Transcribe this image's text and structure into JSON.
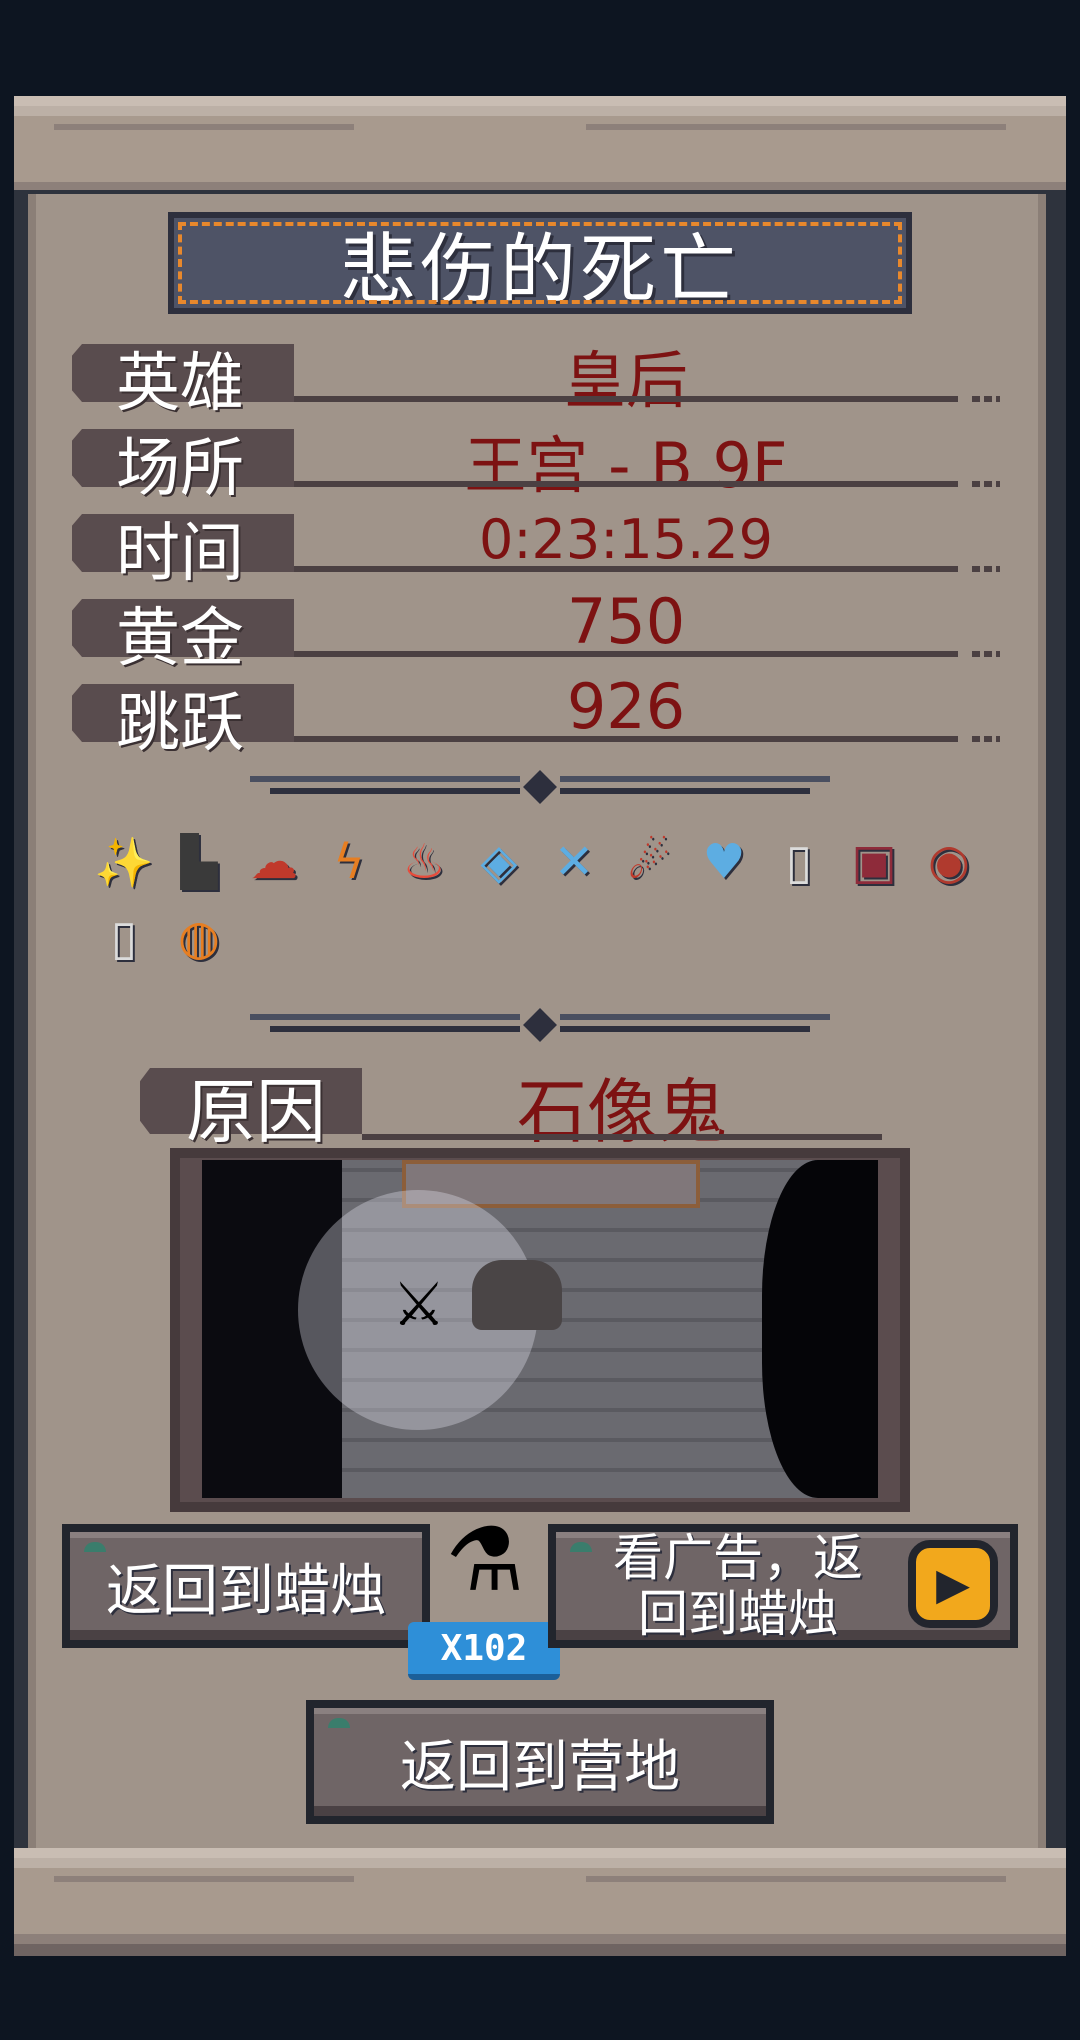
{
  "title": "悲伤的死亡",
  "stats": [
    {
      "label": "英雄",
      "value": "皇后"
    },
    {
      "label": "场所",
      "value": "王宫 - B 9F"
    },
    {
      "label": "时间",
      "value": "0:23:15.29"
    },
    {
      "label": "黄金",
      "value": "750"
    },
    {
      "label": "跳跃",
      "value": "926"
    }
  ],
  "items": [
    {
      "icon": "stars-icon",
      "glyph": "✨",
      "color": "#7ab8ff"
    },
    {
      "icon": "boot-icon",
      "glyph": "▙",
      "color": "#3a3a3a"
    },
    {
      "icon": "mushroom-cloud-icon",
      "glyph": "☁",
      "color": "#c0392b"
    },
    {
      "icon": "lightning-icon",
      "glyph": "ϟ",
      "color": "#e67e22"
    },
    {
      "icon": "fire-icon",
      "glyph": "♨",
      "color": "#e74c3c"
    },
    {
      "icon": "ice-cube-icon",
      "glyph": "◈",
      "color": "#5dade2"
    },
    {
      "icon": "crossed-swords-icon",
      "glyph": "✕",
      "color": "#5dade2"
    },
    {
      "icon": "comet-icon",
      "glyph": "☄",
      "color": "#c0392b"
    },
    {
      "icon": "heart-icon",
      "glyph": "♥",
      "color": "#5dade2"
    },
    {
      "icon": "jar-icon",
      "glyph": "▯",
      "color": "#dcdcdc"
    },
    {
      "icon": "chest-icon",
      "glyph": "▣",
      "color": "#8e2b3a"
    },
    {
      "icon": "target-icon",
      "glyph": "◉",
      "color": "#b03a2e"
    },
    {
      "icon": "jar-icon",
      "glyph": "▯",
      "color": "#dcdcdc"
    },
    {
      "icon": "fire-orb-icon",
      "glyph": "◍",
      "color": "#e67e22"
    }
  ],
  "cause": {
    "label": "原因",
    "value": "石像鬼"
  },
  "buttons": {
    "return_candle": "返回到蜡烛",
    "ad_return_line1": "看广告，返",
    "ad_return_line2": "回到蜡烛",
    "return_camp": "返回到营地"
  },
  "potion_count": "X102",
  "colors": {
    "value_red": "#7d1212",
    "accent_orange": "#e8882c",
    "badge_blue": "#2e8fd8"
  }
}
